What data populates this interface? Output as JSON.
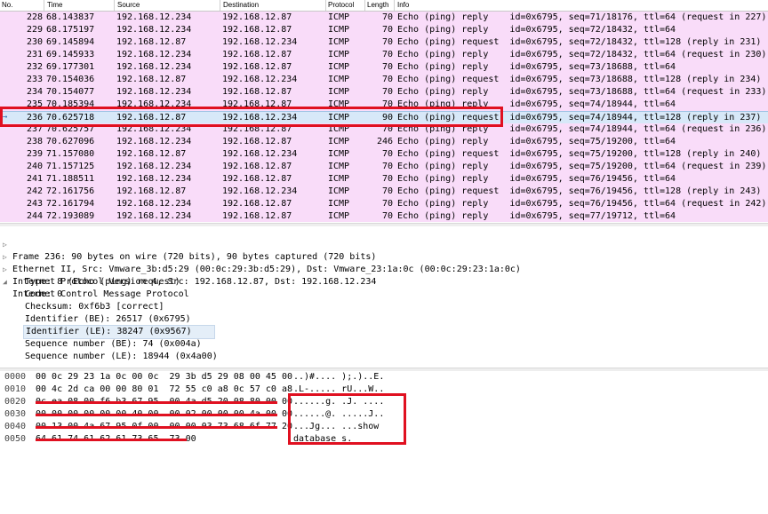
{
  "columns": {
    "no": "No.",
    "time": "Time",
    "source": "Source",
    "destination": "Destination",
    "protocol": "Protocol",
    "length": "Length",
    "info": "Info"
  },
  "packets": [
    {
      "no": "228",
      "time": "68.143837",
      "src": "192.168.12.234",
      "dst": "192.168.12.87",
      "proto": "ICMP",
      "len": "70",
      "info": "Echo (ping) reply    id=0x6795, seq=71/18176, ttl=64 (request in 227)"
    },
    {
      "no": "229",
      "time": "68.175197",
      "src": "192.168.12.234",
      "dst": "192.168.12.87",
      "proto": "ICMP",
      "len": "70",
      "info": "Echo (ping) reply    id=0x6795, seq=72/18432, ttl=64"
    },
    {
      "no": "230",
      "time": "69.145894",
      "src": "192.168.12.87",
      "dst": "192.168.12.234",
      "proto": "ICMP",
      "len": "70",
      "info": "Echo (ping) request  id=0x6795, seq=72/18432, ttl=128 (reply in 231)"
    },
    {
      "no": "231",
      "time": "69.145933",
      "src": "192.168.12.234",
      "dst": "192.168.12.87",
      "proto": "ICMP",
      "len": "70",
      "info": "Echo (ping) reply    id=0x6795, seq=72/18432, ttl=64 (request in 230)"
    },
    {
      "no": "232",
      "time": "69.177301",
      "src": "192.168.12.234",
      "dst": "192.168.12.87",
      "proto": "ICMP",
      "len": "70",
      "info": "Echo (ping) reply    id=0x6795, seq=73/18688, ttl=64"
    },
    {
      "no": "233",
      "time": "70.154036",
      "src": "192.168.12.87",
      "dst": "192.168.12.234",
      "proto": "ICMP",
      "len": "70",
      "info": "Echo (ping) request  id=0x6795, seq=73/18688, ttl=128 (reply in 234)"
    },
    {
      "no": "234",
      "time": "70.154077",
      "src": "192.168.12.234",
      "dst": "192.168.12.87",
      "proto": "ICMP",
      "len": "70",
      "info": "Echo (ping) reply    id=0x6795, seq=73/18688, ttl=64 (request in 233)"
    },
    {
      "no": "235",
      "time": "70.185394",
      "src": "192.168.12.234",
      "dst": "192.168.12.87",
      "proto": "ICMP",
      "len": "70",
      "info": "Echo (ping) reply    id=0x6795, seq=74/18944, ttl=64"
    },
    {
      "no": "236",
      "time": "70.625718",
      "src": "192.168.12.87",
      "dst": "192.168.12.234",
      "proto": "ICMP",
      "len": "90",
      "info": "Echo (ping) request  id=0x6795, seq=74/18944, ttl=128 (reply in 237)",
      "selected": true
    },
    {
      "no": "237",
      "time": "70.625757",
      "src": "192.168.12.234",
      "dst": "192.168.12.87",
      "proto": "ICMP",
      "len": "70",
      "info": "Echo (ping) reply    id=0x6795, seq=74/18944, ttl=64 (request in 236)"
    },
    {
      "no": "238",
      "time": "70.627096",
      "src": "192.168.12.234",
      "dst": "192.168.12.87",
      "proto": "ICMP",
      "len": "246",
      "info": "Echo (ping) reply    id=0x6795, seq=75/19200, ttl=64"
    },
    {
      "no": "239",
      "time": "71.157080",
      "src": "192.168.12.87",
      "dst": "192.168.12.234",
      "proto": "ICMP",
      "len": "70",
      "info": "Echo (ping) request  id=0x6795, seq=75/19200, ttl=128 (reply in 240)"
    },
    {
      "no": "240",
      "time": "71.157125",
      "src": "192.168.12.234",
      "dst": "192.168.12.87",
      "proto": "ICMP",
      "len": "70",
      "info": "Echo (ping) reply    id=0x6795, seq=75/19200, ttl=64 (request in 239)"
    },
    {
      "no": "241",
      "time": "71.188511",
      "src": "192.168.12.234",
      "dst": "192.168.12.87",
      "proto": "ICMP",
      "len": "70",
      "info": "Echo (ping) reply    id=0x6795, seq=76/19456, ttl=64"
    },
    {
      "no": "242",
      "time": "72.161756",
      "src": "192.168.12.87",
      "dst": "192.168.12.234",
      "proto": "ICMP",
      "len": "70",
      "info": "Echo (ping) request  id=0x6795, seq=76/19456, ttl=128 (reply in 243)"
    },
    {
      "no": "243",
      "time": "72.161794",
      "src": "192.168.12.234",
      "dst": "192.168.12.87",
      "proto": "ICMP",
      "len": "70",
      "info": "Echo (ping) reply    id=0x6795, seq=76/19456, ttl=64 (request in 242)"
    },
    {
      "no": "244",
      "time": "72.193089",
      "src": "192.168.12.234",
      "dst": "192.168.12.87",
      "proto": "ICMP",
      "len": "70",
      "info": "Echo (ping) reply    id=0x6795, seq=77/19712, ttl=64"
    }
  ],
  "details": {
    "frame": "Frame 236: 90 bytes on wire (720 bits), 90 bytes captured (720 bits)",
    "ethernet": "Ethernet II, Src: Vmware_3b:d5:29 (00:0c:29:3b:d5:29), Dst: Vmware_23:1a:0c (00:0c:29:23:1a:0c)",
    "ip": "Internet Protocol Version 4, Src: 192.168.12.87, Dst: 192.168.12.234",
    "icmp": "Internet Control Message Protocol",
    "icmp_fields": [
      "Type: 8 (Echo (ping) request)",
      "Code: 0",
      "Checksum: 0xf6b3 [correct]",
      "Identifier (BE): 26517 (0x6795)",
      "Identifier (LE): 38247 (0x9567)",
      "Sequence number (BE): 74 (0x004a)",
      "Sequence number (LE): 18944 (0x4a00)"
    ]
  },
  "hex_rows": [
    {
      "offset": "0000",
      "bytes": "00 0c 29 23 1a 0c 00 0c  29 3b d5 29 08 00 45 00",
      "ascii": "..)#.... );.)..E."
    },
    {
      "offset": "0010",
      "bytes": "00 4c 2d ca 00 00 80 01  72 55 c0 a8 0c 57 c0 a8",
      "ascii": ".L-..... rU...W.."
    },
    {
      "offset": "0020",
      "bytes": "0c ea 08 00 f6 b3 67 95  00 4a d5 20 08 80 00 00",
      "ascii": "......g. .J. ...."
    },
    {
      "offset": "0030",
      "bytes": "00 00 00 00 00 00 40 00  00 02 00 00 00 4a 00 00",
      "ascii": "......@. .....J.."
    },
    {
      "offset": "0040",
      "bytes": "00 13 00 4a 67 95 0f 00  00 00 03 73 68 6f 77 20",
      "ascii": "...Jg... ...show "
    },
    {
      "offset": "0050",
      "bytes": "64 61 74 61 62 61 73 65  73 00",
      "ascii": "database s."
    }
  ]
}
